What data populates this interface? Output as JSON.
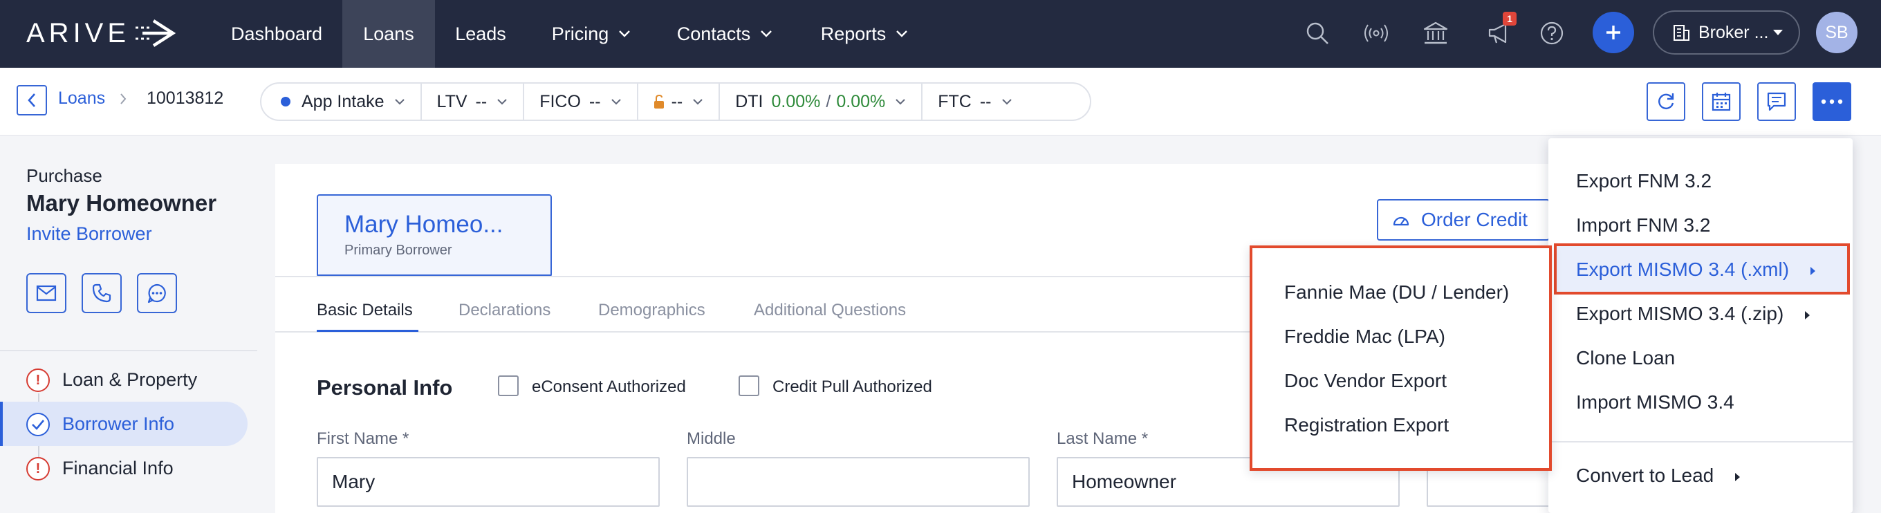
{
  "brand": {
    "logo_text": "ARIVE"
  },
  "topnav": {
    "items": [
      {
        "label": "Dashboard"
      },
      {
        "label": "Loans"
      },
      {
        "label": "Leads"
      },
      {
        "label": "Pricing"
      },
      {
        "label": "Contacts"
      },
      {
        "label": "Reports"
      }
    ],
    "active": "Loans",
    "notification_count": "1",
    "broker_label": "Broker ...",
    "user_initials": "SB"
  },
  "subheader": {
    "breadcrumb_root": "Loans",
    "loan_number": "10013812",
    "status_label": "App Intake",
    "ltv_label": "LTV",
    "ltv_value": "--",
    "fico_label": "FICO",
    "fico_value": "--",
    "lock_value": "--",
    "dti_label": "DTI",
    "dti_front": "0.00%",
    "dti_sep": "/",
    "dti_back": "0.00%",
    "ftc_label": "FTC",
    "ftc_value": "--"
  },
  "sidebar": {
    "loan_purpose": "Purchase",
    "borrower_name": "Mary Homeowner",
    "invite_label": "Invite Borrower",
    "steps": [
      {
        "label": "Loan & Property",
        "status": "error"
      },
      {
        "label": "Borrower Info",
        "status": "active"
      },
      {
        "label": "Financial Info",
        "status": "error"
      }
    ]
  },
  "main": {
    "borrower_card": {
      "name": "Mary Homeo...",
      "role": "Primary Borrower"
    },
    "order_credit_label": "Order Credit",
    "tabs": [
      {
        "label": "Basic Details"
      },
      {
        "label": "Declarations"
      },
      {
        "label": "Demographics"
      },
      {
        "label": "Additional Questions"
      }
    ],
    "active_tab": "Basic Details",
    "section_title": "Personal Info",
    "econsent_label": "eConsent Authorized",
    "credit_pull_label": "Credit Pull Authorized",
    "fields": {
      "first_name_label": "First Name *",
      "first_name_value": "Mary",
      "middle_label": "Middle",
      "middle_value": "",
      "last_name_label": "Last Name *",
      "last_name_value": "Homeowner"
    }
  },
  "menu": {
    "items": [
      {
        "label": "Export FNM 3.2"
      },
      {
        "label": "Import FNM 3.2"
      },
      {
        "label": "Export MISMO 3.4 (.xml)"
      },
      {
        "label": "Export MISMO 3.4 (.zip)"
      },
      {
        "label": "Clone Loan"
      },
      {
        "label": "Import MISMO 3.4"
      },
      {
        "label": "Convert to Lead"
      }
    ],
    "highlighted": "Export MISMO 3.4 (.xml)"
  },
  "submenu": {
    "items": [
      {
        "label": "Fannie Mae (DU / Lender)"
      },
      {
        "label": "Freddie Mac (LPA)"
      },
      {
        "label": "Doc Vendor Export"
      },
      {
        "label": "Registration Export"
      }
    ]
  },
  "colors": {
    "nav_bg": "#232a40",
    "accent": "#2b5fd9",
    "highlight_border": "#e24a2d",
    "success": "#2e8a3a",
    "error": "#d63b32"
  }
}
